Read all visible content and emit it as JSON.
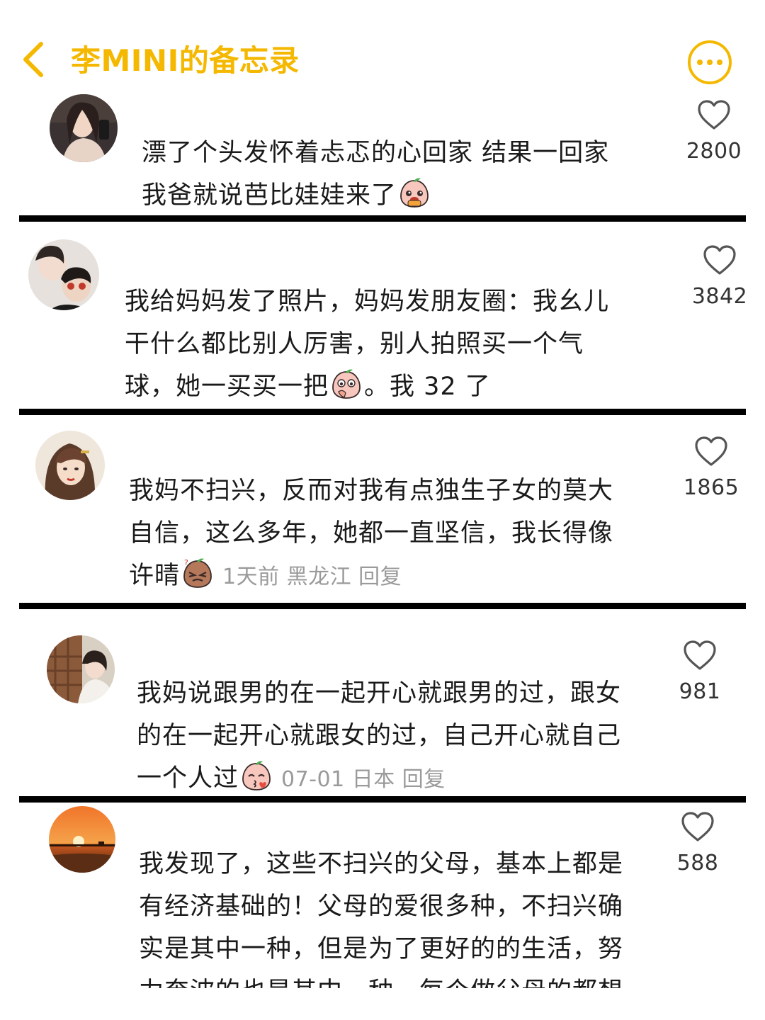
{
  "header": {
    "title": "李MINI的备忘录",
    "back_icon": "chevron-left-icon",
    "more_icon": "more-dots-icon",
    "accent_color": "#F5B800"
  },
  "comments": [
    {
      "lines": [
        "漂了个头发怀着忐忑的心回家 结果一回家",
        "我爸就说芭比娃娃来了"
      ],
      "emoji": "peach-pleading-emoji",
      "likes": "2800"
    },
    {
      "lines": [
        "我给妈妈发了照片，妈妈发朋友圈：我幺儿",
        "干什么都比别人厉害，别人拍照买一个气",
        "球，她一买买一把",
        "。我 32 了"
      ],
      "emoji": "peach-thinking-emoji",
      "likes": "3842"
    },
    {
      "lines": [
        "我妈不扫兴，反而对我有点独生子女的莫大",
        "自信，这么多年，她都一直坚信，我长得像",
        "许晴"
      ],
      "emoji": "peach-confused-emoji",
      "time": "1天前",
      "location": "黑龙江",
      "reply": "回复",
      "likes": "1865"
    },
    {
      "lines": [
        "我妈说跟男的在一起开心就跟男的过，跟女",
        "的在一起开心就跟女的过，自己开心就自己",
        "一个人过"
      ],
      "emoji": "peach-kiss-emoji",
      "time": "07-01",
      "location": "日本",
      "reply": "回复",
      "likes": "981"
    },
    {
      "lines": [
        "我发现了，这些不扫兴的父母，基本上都是",
        "有经济基础的！父母的爱很多种，不扫兴确",
        "实是其中一种，但是为了更好的的生活，努",
        "力奔波的也是其中一种，每个做父母的都想"
      ],
      "likes": "588"
    }
  ]
}
